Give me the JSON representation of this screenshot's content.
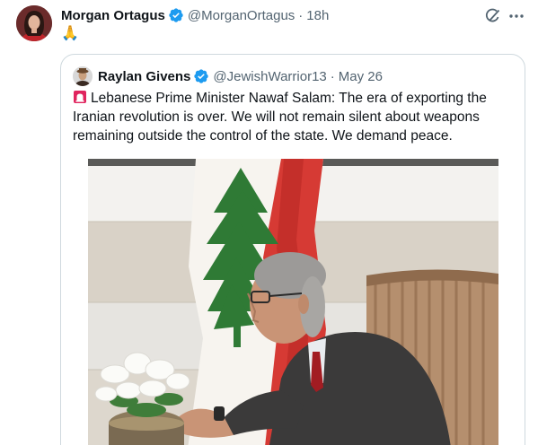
{
  "tweet": {
    "author_name": "Morgan Ortagus",
    "author_handle": "@MorganOrtagus",
    "separator": "·",
    "time": "18h",
    "text": "🙏",
    "icons": {
      "verified": "verified-badge-icon",
      "grok": "grok-icon",
      "more": "more-options-icon"
    },
    "colors": {
      "verified": "#1d9bf0",
      "secondary_text": "#536471",
      "border": "#cfd9de"
    }
  },
  "quote": {
    "author_name": "Raylan Givens",
    "author_handle": "@JewishWarrior13",
    "separator": "·",
    "date": "May 26",
    "text": "Lebanese Prime Minister Nawaf Salam: The era of exporting the Iranian revolution is over. We will not remain silent about weapons remaining outside the control of the state. We demand peace.",
    "leading_icon": "siren-icon",
    "image": "photo of man seated beside Lebanese flag with white flower arrangement"
  }
}
